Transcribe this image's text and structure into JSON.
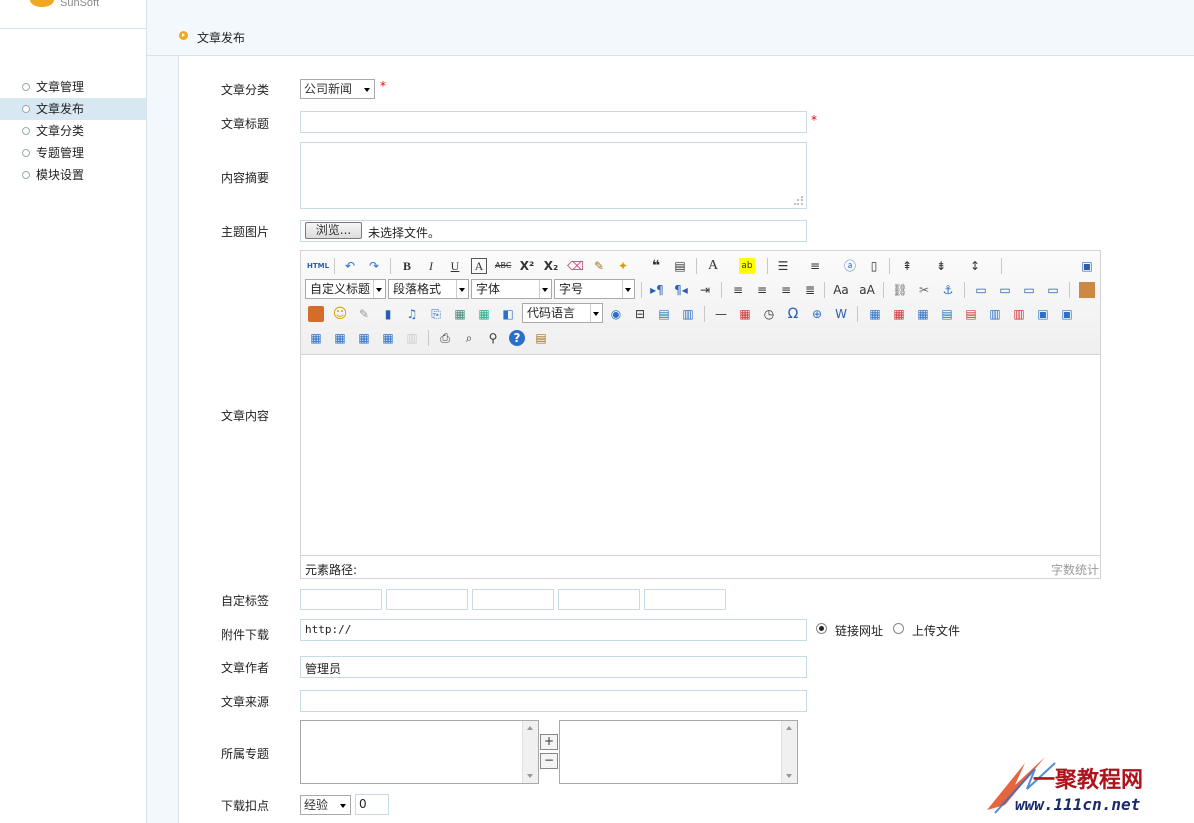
{
  "sidebar": {
    "items": [
      {
        "label": "文章管理"
      },
      {
        "label": "文章发布",
        "active": true
      },
      {
        "label": "文章分类"
      },
      {
        "label": "专题管理"
      },
      {
        "label": "模块设置"
      }
    ]
  },
  "header": {
    "title": "文章发布"
  },
  "form": {
    "category": {
      "label": "文章分类",
      "value": "公司新闻",
      "required": "*"
    },
    "title": {
      "label": "文章标题",
      "value": "",
      "required": "*"
    },
    "summary": {
      "label": "内容摘要",
      "value": ""
    },
    "image": {
      "label": "主题图片",
      "browse": "浏览...",
      "status": "未选择文件。"
    },
    "content": {
      "label": "文章内容",
      "element_path": "元素路径:",
      "word_count": "字数统计"
    },
    "tags": {
      "label": "自定标签"
    },
    "attachment": {
      "label": "附件下载",
      "value": "http://",
      "opt_link": "链接网址",
      "opt_upload": "上传文件"
    },
    "author": {
      "label": "文章作者",
      "value": "管理员"
    },
    "source": {
      "label": "文章来源",
      "value": ""
    },
    "topic": {
      "label": "所属专题",
      "add": "+",
      "remove": "−"
    },
    "download": {
      "label": "下载扣点",
      "type": "经验",
      "value": "0"
    }
  },
  "toolbar": {
    "heading": "自定义标题",
    "paragraph": "段落格式",
    "font": "字体",
    "size": "字号",
    "code": "代码语言",
    "html": "HTML"
  },
  "watermark": {
    "text": "一聚教程网",
    "url": "www.111cn.net"
  },
  "colors": {
    "accent": "#f0a81e",
    "border": "#c7dbe6",
    "active": "#d7e8f3"
  }
}
